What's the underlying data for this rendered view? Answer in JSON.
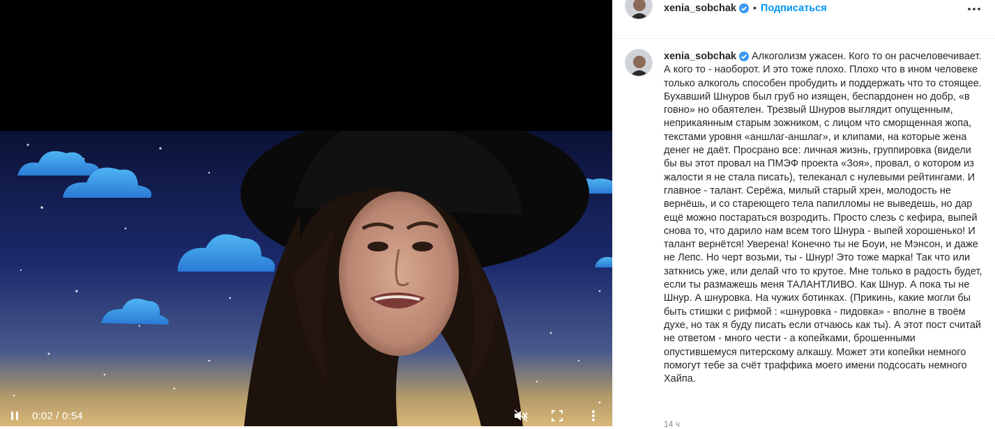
{
  "video": {
    "current_time": "0:02",
    "duration": "0:54",
    "time_separator": " / "
  },
  "post": {
    "username": "xenia_sobchak",
    "verified": true,
    "header_separator": "•",
    "follow_label": "Подписаться",
    "caption": "Алкоголизм ужасен. Кого то он расчеловечивает. А кого то - наоборот. И это тоже плохо. Плохо что в ином человеке только алкоголь способен пробудить и поддержать что то стоящее. Бухавший Шнуров был груб но изящен, беспардонен но добр, «в говно» но обаятелен. Трезвый Шнуров выглядит опущенным, неприкаянным старым зожником, с лицом что сморщенная жопа, текстами уровня «аншлаг-аншлаг», и клипами, на которые жена денег не даёт. Просрано все: личная жизнь, группировка (видели бы вы этот провал на ПМЭФ проекта «Зоя», провал, о котором из жалости я не стала писать), телеканал с нулевыми рейтингами. И главное - талант. Серёжа, милый старый хрен, молодость не вернёшь, и со стареющего тела папилломы не выведешь, но дар ещё можно постараться возродить. Просто слезь с кефира, выпей снова то, что дарило нам всем того Шнура - выпей хорошенько! И талант вернётся! Уверена! Конечно ты не Боуи, не Мэнсон, и даже не Лепс. Но черт возьми, ты - Шнур! Это тоже марка! Так что или заткнись уже, или делай что то крутое. Мне только в радость будет, если ты размажешь меня ТАЛАНТЛИВО. Как Шнур. А пока ты не Шнур. А шнуровка. На чужих ботинках. (Прикинь, какие могли бы быть стишки с рифмой : «шнуровка - пидовка» - вполне в твоём духе, но так я буду писать если отчаюсь как ты). А этот пост считай не ответом - много чести - а копейками, брошенными опустившемуся питерскому алкашу. Может эти копейки немного помогут тебе за счёт траффика моего имени подсосать немного Хайпа.",
    "time_ago": "14 ч"
  },
  "colors": {
    "accent": "#0095f6",
    "verified_badge": "#3897f0",
    "text": "#262626",
    "muted": "#8e8e8e"
  },
  "icons": {
    "pause": "pause-icon",
    "mute": "muted-speaker-icon",
    "fullscreen": "fullscreen-icon",
    "more": "more-vertical-icon",
    "post_more": "more-horizontal-icon",
    "verified": "verified-badge-icon"
  }
}
